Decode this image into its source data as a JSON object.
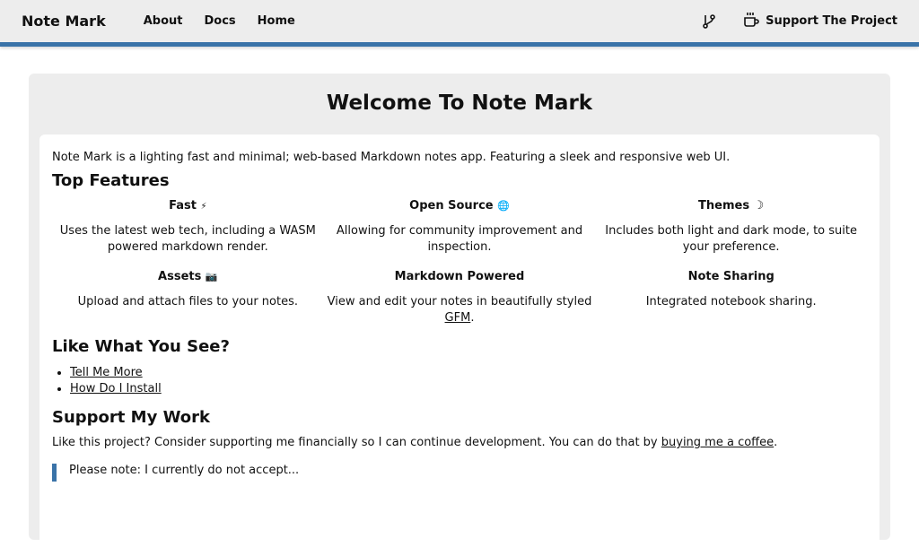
{
  "nav": {
    "brand": "Note Mark",
    "links": [
      "About",
      "Docs",
      "Home"
    ],
    "support": "Support The Project"
  },
  "main": {
    "title": "Welcome To Note Mark",
    "intro": "Note Mark is a lighting fast and minimal; web-based Markdown notes app. Featuring a sleek and responsive web UI.",
    "features_heading": "Top Features",
    "features": [
      {
        "title": "Fast",
        "icon": "⚡",
        "desc": "Uses the latest web tech, including a WASM powered markdown render."
      },
      {
        "title": "Open Source",
        "icon": "🌐",
        "desc": "Allowing for community improvement and inspection."
      },
      {
        "title": "Themes",
        "icon": "☽",
        "desc": "Includes both light and dark mode, to suite your preference."
      },
      {
        "title": "Assets",
        "icon": "📷",
        "desc": "Upload and attach files to your notes."
      },
      {
        "title": "Markdown Powered",
        "icon": "",
        "desc": "View and edit your notes in beautifully styled",
        "link": "GFM",
        "after": "."
      },
      {
        "title": "Note Sharing",
        "icon": "",
        "desc": "Integrated notebook sharing."
      }
    ],
    "like_heading": "Like What You See?",
    "like_links": [
      "Tell Me More",
      "How Do I Install"
    ],
    "support_heading": "Support My Work",
    "support_text": "Like this project? Consider supporting me financially so I can continue development. You can do that by",
    "support_link": "buying me a coffee",
    "support_end": ".",
    "note": "Please note: I currently do not accept... "
  }
}
